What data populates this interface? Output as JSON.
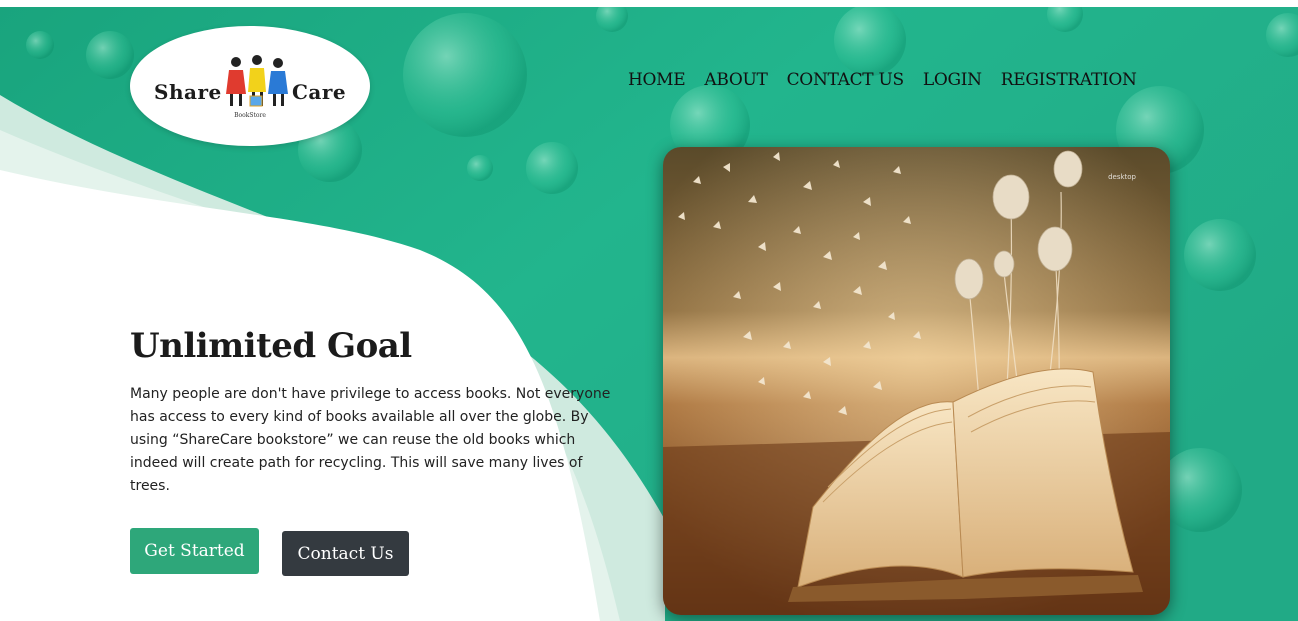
{
  "brand": {
    "name_left": "Share",
    "name_right": "Care",
    "tagline": "BookStore"
  },
  "nav": {
    "items": [
      {
        "label": "HOME"
      },
      {
        "label": "ABOUT"
      },
      {
        "label": "CONTACT US"
      },
      {
        "label": "LOGIN"
      },
      {
        "label": "REGISTRATION"
      }
    ]
  },
  "hero": {
    "title": "Unlimited Goal",
    "text": "Many people are don't have privilege to access books. Not everyone has access to every kind of books available all over the globe. By using “ShareCare bookstore” we can reuse the old books which indeed will create path for recycling. This will save many lives of trees.",
    "primary_button": "Get Started",
    "secondary_button": "Contact Us"
  },
  "image": {
    "watermark": "desktop"
  },
  "colors": {
    "accent": "#2ea77a",
    "dark_button": "#343a40",
    "background_green": "#1fae86"
  }
}
